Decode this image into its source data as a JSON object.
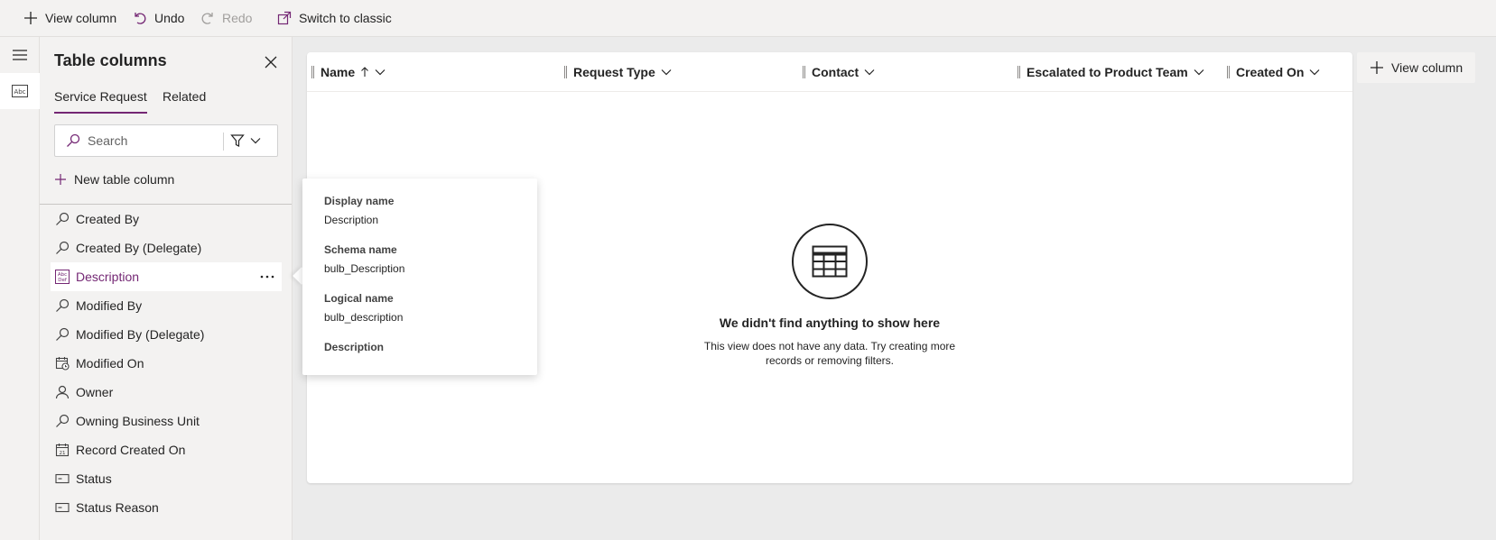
{
  "toolbar": {
    "view_column": "View column",
    "undo": "Undo",
    "redo": "Redo",
    "switch_classic": "Switch to classic"
  },
  "panel": {
    "title": "Table columns",
    "tabs": [
      {
        "label": "Service Request",
        "active": true
      },
      {
        "label": "Related",
        "active": false
      }
    ],
    "search_placeholder": "Search",
    "new_column": "New table column",
    "columns": [
      {
        "label": "Created By",
        "icon": "lookup-icon"
      },
      {
        "label": "Created By (Delegate)",
        "icon": "lookup-icon"
      },
      {
        "label": "Description",
        "icon": "text-field-icon",
        "selected": true
      },
      {
        "label": "Modified By",
        "icon": "lookup-icon"
      },
      {
        "label": "Modified By (Delegate)",
        "icon": "lookup-icon"
      },
      {
        "label": "Modified On",
        "icon": "calendar-clock-icon"
      },
      {
        "label": "Owner",
        "icon": "person-icon"
      },
      {
        "label": "Owning Business Unit",
        "icon": "lookup-icon"
      },
      {
        "label": "Record Created On",
        "icon": "calendar-icon"
      },
      {
        "label": "Status",
        "icon": "option-set-icon"
      },
      {
        "label": "Status Reason",
        "icon": "option-set-icon"
      }
    ]
  },
  "grid": {
    "columns": [
      {
        "label": "Name",
        "sort": "ascending"
      },
      {
        "label": "Request Type"
      },
      {
        "label": "Contact"
      },
      {
        "label": "Escalated to Product Team"
      },
      {
        "label": "Created On"
      }
    ],
    "add_column": "View column",
    "empty_title": "We didn't find anything to show here",
    "empty_description": "This view does not have any data. Try creating more records or removing filters."
  },
  "flyout": {
    "display_name_label": "Display name",
    "display_name": "Description",
    "schema_name_label": "Schema name",
    "schema_name": "bulb_Description",
    "logical_name_label": "Logical name",
    "logical_name": "bulb_description",
    "description_label": "Description"
  },
  "colors": {
    "accent": "#742774",
    "text": "#242424",
    "background": "#ebebeb"
  }
}
